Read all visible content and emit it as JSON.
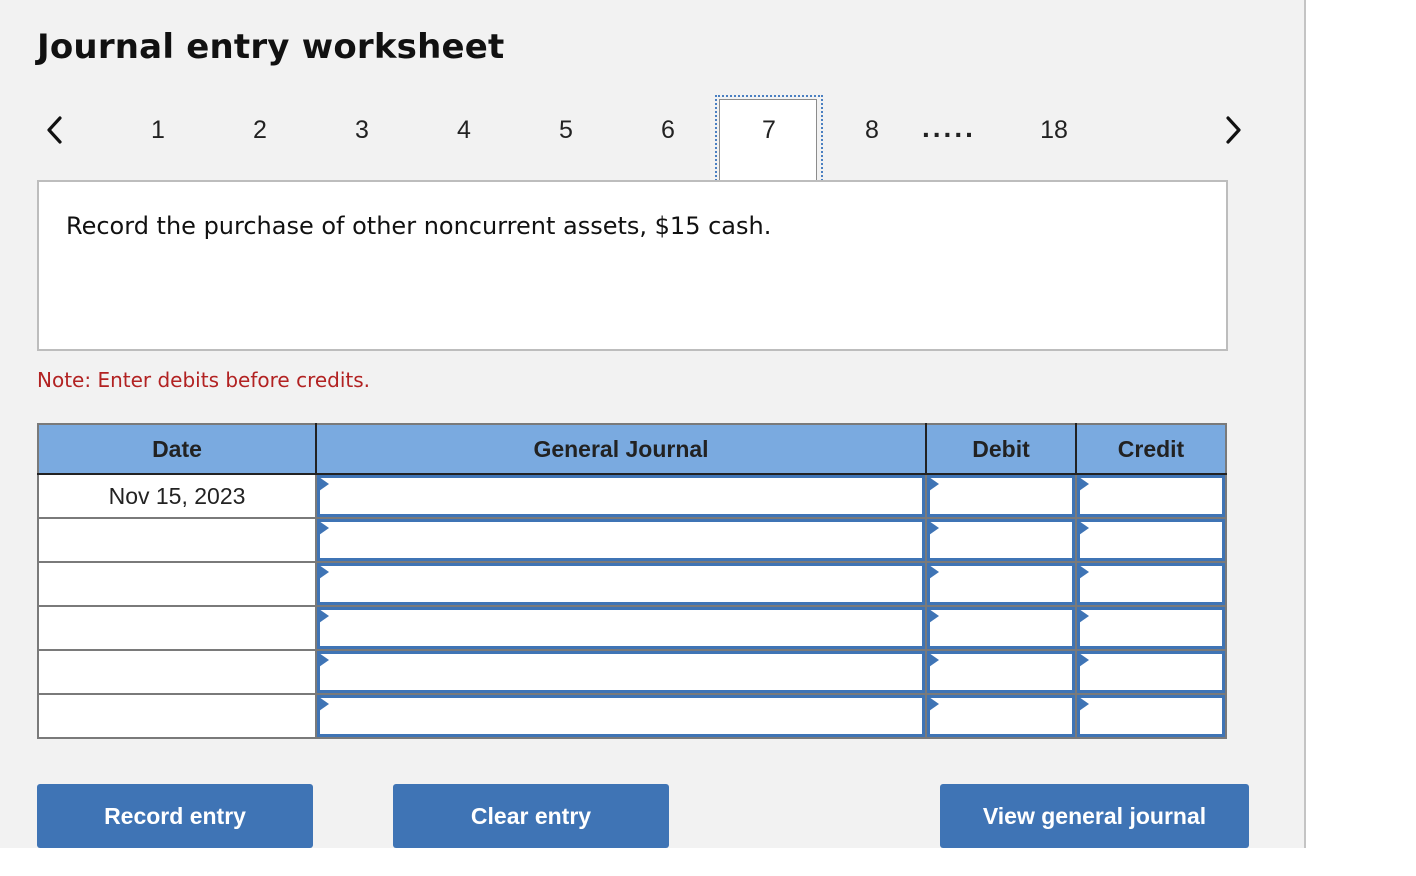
{
  "page": {
    "title": "Journal entry worksheet"
  },
  "pager": {
    "prev_icon": "chevron-left-icon",
    "next_icon": "chevron-right-icon",
    "pages": [
      "1",
      "2",
      "3",
      "4",
      "5",
      "6",
      "7",
      "8"
    ],
    "current": "7",
    "ellipsis": ".....",
    "last": "18"
  },
  "question": {
    "text": "Record the purchase of other noncurrent assets, $15 cash."
  },
  "note": "Note: Enter debits before credits.",
  "journal": {
    "headers": {
      "date": "Date",
      "account": "General Journal",
      "debit": "Debit",
      "credit": "Credit"
    },
    "rows": [
      {
        "date": "Nov 15, 2023",
        "account": "",
        "debit": "",
        "credit": ""
      },
      {
        "date": "",
        "account": "",
        "debit": "",
        "credit": ""
      },
      {
        "date": "",
        "account": "",
        "debit": "",
        "credit": ""
      },
      {
        "date": "",
        "account": "",
        "debit": "",
        "credit": ""
      },
      {
        "date": "",
        "account": "",
        "debit": "",
        "credit": ""
      },
      {
        "date": "",
        "account": "",
        "debit": "",
        "credit": ""
      }
    ]
  },
  "buttons": {
    "record": "Record entry",
    "clear": "Clear entry",
    "view": "View general journal"
  },
  "colors": {
    "accent": "#3f74b5",
    "header_bg": "#7aaae0",
    "note": "#b22222"
  }
}
